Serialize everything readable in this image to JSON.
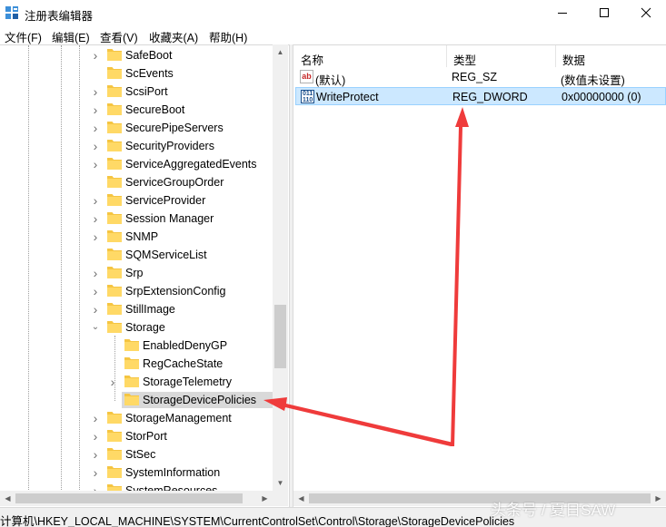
{
  "window": {
    "title": "注册表编辑器",
    "controls": {
      "minimize": "minimize",
      "maximize": "maximize",
      "close": "close"
    }
  },
  "menu": [
    "文件(F)",
    "编辑(E)",
    "查看(V)",
    "收藏夹(A)",
    "帮助(H)"
  ],
  "tree": {
    "items": [
      {
        "label": "SafeBoot",
        "level": 1,
        "expander": "collapsed"
      },
      {
        "label": "ScEvents",
        "level": 1,
        "expander": "none"
      },
      {
        "label": "ScsiPort",
        "level": 1,
        "expander": "collapsed"
      },
      {
        "label": "SecureBoot",
        "level": 1,
        "expander": "collapsed"
      },
      {
        "label": "SecurePipeServers",
        "level": 1,
        "expander": "collapsed"
      },
      {
        "label": "SecurityProviders",
        "level": 1,
        "expander": "collapsed"
      },
      {
        "label": "ServiceAggregatedEvents",
        "level": 1,
        "expander": "collapsed"
      },
      {
        "label": "ServiceGroupOrder",
        "level": 1,
        "expander": "none"
      },
      {
        "label": "ServiceProvider",
        "level": 1,
        "expander": "collapsed"
      },
      {
        "label": "Session Manager",
        "level": 1,
        "expander": "collapsed"
      },
      {
        "label": "SNMP",
        "level": 1,
        "expander": "collapsed"
      },
      {
        "label": "SQMServiceList",
        "level": 1,
        "expander": "none"
      },
      {
        "label": "Srp",
        "level": 1,
        "expander": "collapsed"
      },
      {
        "label": "SrpExtensionConfig",
        "level": 1,
        "expander": "collapsed"
      },
      {
        "label": "StillImage",
        "level": 1,
        "expander": "collapsed"
      },
      {
        "label": "Storage",
        "level": 1,
        "expander": "expanded"
      },
      {
        "label": "EnabledDenyGP",
        "level": 2,
        "expander": "none"
      },
      {
        "label": "RegCacheState",
        "level": 2,
        "expander": "none"
      },
      {
        "label": "StorageTelemetry",
        "level": 2,
        "expander": "collapsed"
      },
      {
        "label": "StorageDevicePolicies",
        "level": 2,
        "expander": "none",
        "selected": true
      },
      {
        "label": "StorageManagement",
        "level": 1,
        "expander": "collapsed"
      },
      {
        "label": "StorPort",
        "level": 1,
        "expander": "collapsed"
      },
      {
        "label": "StSec",
        "level": 1,
        "expander": "collapsed"
      },
      {
        "label": "SystemInformation",
        "level": 1,
        "expander": "collapsed"
      },
      {
        "label": "SystemResources",
        "level": 1,
        "expander": "collapsed"
      }
    ]
  },
  "list": {
    "columns": [
      "名称",
      "类型",
      "数据"
    ],
    "rows": [
      {
        "name": "(默认)",
        "type": "REG_SZ",
        "data": "(数值未设置)",
        "icon": "string-value-icon",
        "icon_text": "ab"
      },
      {
        "name": "WriteProtect",
        "type": "REG_DWORD",
        "data": "0x00000000 (0)",
        "icon": "binary-value-icon",
        "icon_text": "011 110",
        "selected": true
      }
    ]
  },
  "status": {
    "path": "计算机\\HKEY_LOCAL_MACHINE\\SYSTEM\\CurrentControlSet\\Control\\Storage\\StorageDevicePolicies"
  },
  "watermark": "头条号 / 夏日SAW",
  "colors": {
    "selection_bg": "#cce8ff",
    "selection_border": "#99d1ff",
    "tree_selected_bg": "#d9d9d9",
    "folder": "#f5c542",
    "annotation_arrow": "#ef3b3b"
  }
}
